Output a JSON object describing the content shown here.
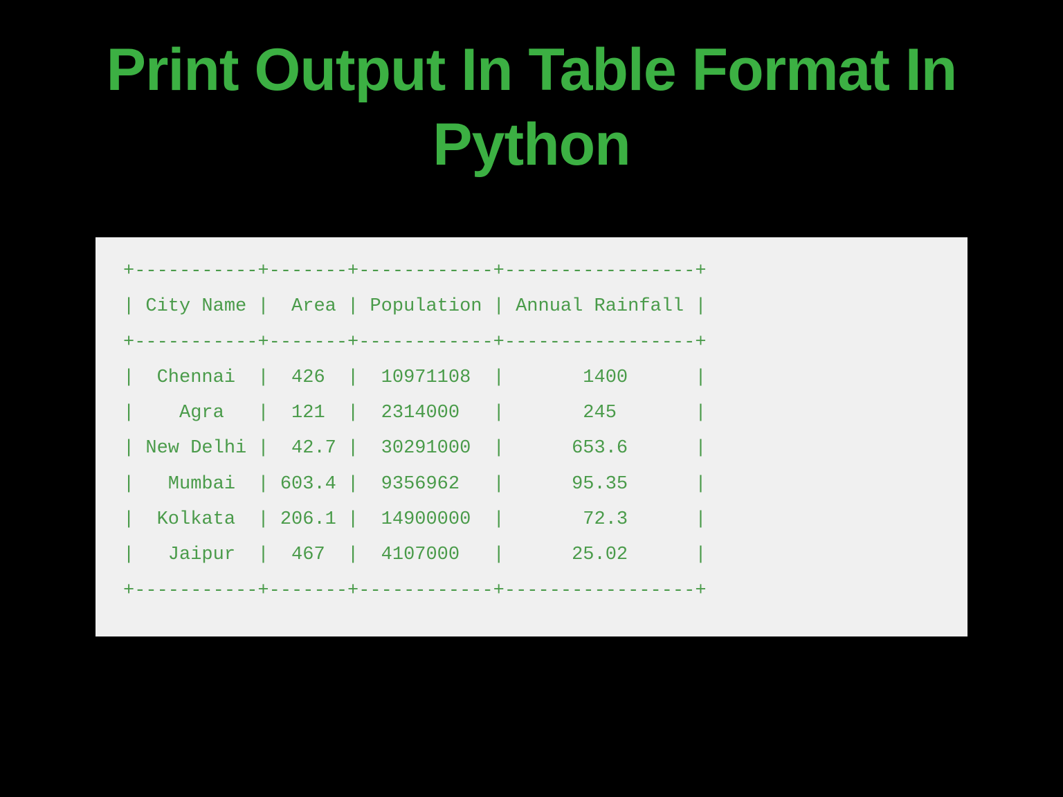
{
  "title": "Print Output In Table Format In Python",
  "chart_data": {
    "type": "table",
    "headers": [
      "City Name",
      "Area",
      "Population",
      "Annual Rainfall"
    ],
    "rows": [
      {
        "city": "Chennai",
        "area": "426",
        "population": "10971108",
        "rainfall": "1400"
      },
      {
        "city": "Agra",
        "area": "121",
        "population": "2314000",
        "rainfall": "245"
      },
      {
        "city": "New Delhi",
        "area": "42.7",
        "population": "30291000",
        "rainfall": "653.6"
      },
      {
        "city": "Mumbai",
        "area": "603.4",
        "population": "9356962",
        "rainfall": "95.35"
      },
      {
        "city": "Kolkata",
        "area": "206.1",
        "population": "14900000",
        "rainfall": "72.3"
      },
      {
        "city": "Jaipur",
        "area": "467",
        "population": "4107000",
        "rainfall": "25.02"
      }
    ]
  },
  "table": {
    "border_top": "+-----------+-------+------------+-----------------+",
    "header": "| City Name |  Area | Population | Annual Rainfall |",
    "border_mid": "+-----------+-------+------------+-----------------+",
    "row0": "|  Chennai  |  426  |  10971108  |       1400      |",
    "row1": "|    Agra   |  121  |  2314000   |       245       |",
    "row2": "| New Delhi |  42.7 |  30291000  |      653.6      |",
    "row3": "|   Mumbai  | 603.4 |  9356962   |      95.35      |",
    "row4": "|  Kolkata  | 206.1 |  14900000  |       72.3      |",
    "row5": "|   Jaipur  |  467  |  4107000   |      25.02      |",
    "border_bot": "+-----------+-------+------------+-----------------+"
  }
}
